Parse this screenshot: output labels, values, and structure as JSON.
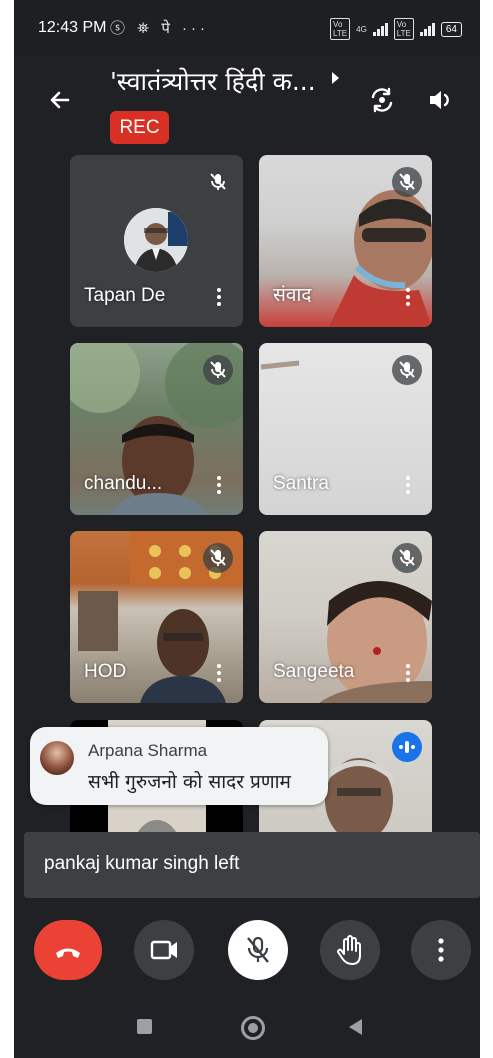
{
  "status_bar": {
    "time": "12:43 PM",
    "app_icons": "ⓢ ⛯ पे ···",
    "network": "4G",
    "battery": "64"
  },
  "header": {
    "meeting_title": "'स्वातंत्र्योत्तर हिंदी क...",
    "rec_label": "REC"
  },
  "participants": [
    {
      "name": "Tapan De",
      "muted": true
    },
    {
      "name": "संवाद",
      "muted": true
    },
    {
      "name": "chandu...",
      "muted": true
    },
    {
      "name": "Santra",
      "muted": true
    },
    {
      "name": "HOD",
      "muted": true
    },
    {
      "name": "Sangeeta",
      "muted": true
    },
    {
      "name": "",
      "muted": true
    },
    {
      "name": "",
      "muted": false
    }
  ],
  "chat_popup": {
    "sender": "Arpana Sharma",
    "message": "सभी गुरुजनो को सादर प्रणाम"
  },
  "toast": {
    "text": "pankaj kumar singh left"
  },
  "colors": {
    "end_call": "#ea4335",
    "rec": "#d93025",
    "speaking": "#1a73e8",
    "background": "#202124"
  }
}
